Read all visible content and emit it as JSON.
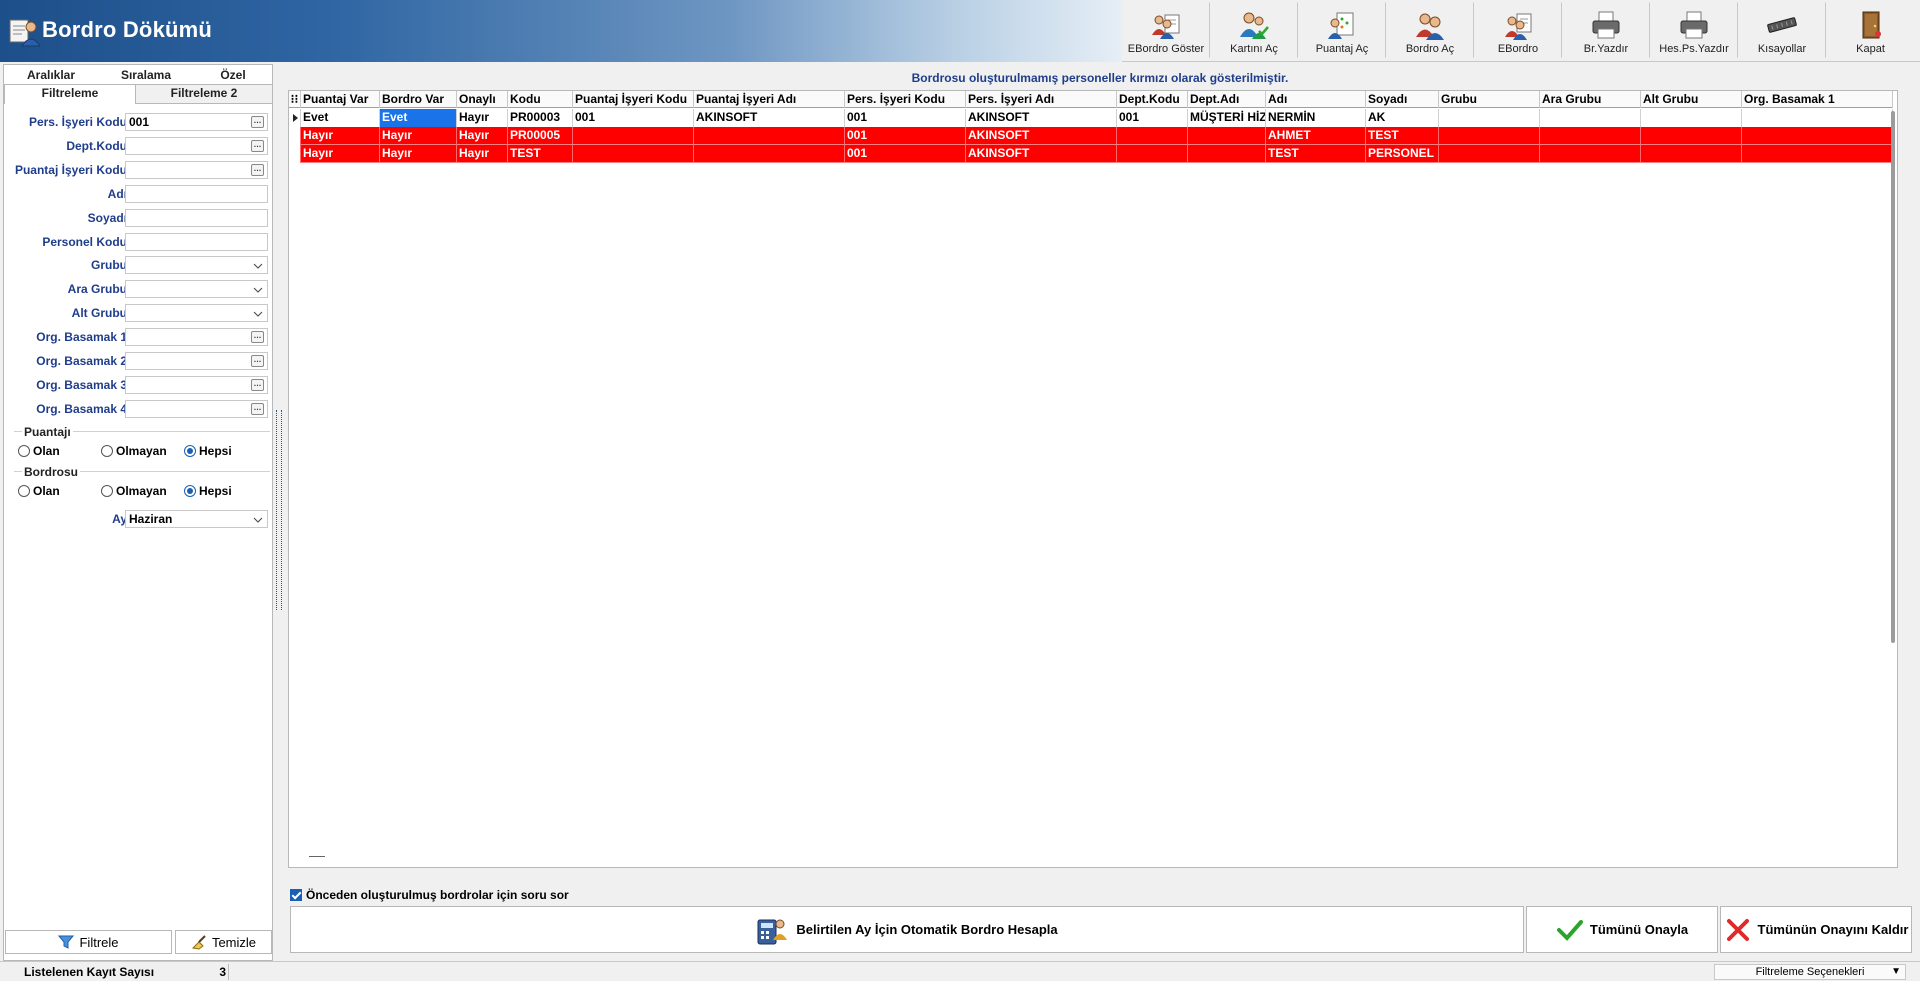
{
  "window": {
    "title": "Bordro Dökümü"
  },
  "toolbar": [
    {
      "label": "EBordro Göster",
      "icon": "people-document-icon"
    },
    {
      "label": "Kartını Aç",
      "icon": "person-check-icon"
    },
    {
      "label": "Puantaj Aç",
      "icon": "timesheet-icon"
    },
    {
      "label": "Bordro Aç",
      "icon": "people-icon"
    },
    {
      "label": "EBordro",
      "icon": "people-document-icon"
    },
    {
      "label": "Br.Yazdır",
      "icon": "printer-icon"
    },
    {
      "label": "Hes.Ps.Yazdır",
      "icon": "printer-icon"
    },
    {
      "label": "Kısayollar",
      "icon": "keyboard-icon"
    },
    {
      "label": "Kapat",
      "icon": "door-exit-icon"
    }
  ],
  "left": {
    "tabs_top": [
      "Aralıklar",
      "Sıralama",
      "Özel"
    ],
    "tabs_bottom": [
      "Filtreleme",
      "Filtreleme 2"
    ],
    "fields": [
      {
        "label": "Pers. İşyeri Kodu",
        "value": "001",
        "type": "lookup"
      },
      {
        "label": "Dept.Kodu",
        "value": "",
        "type": "lookup"
      },
      {
        "label": "Puantaj İşyeri Kodu",
        "value": "",
        "type": "lookup"
      },
      {
        "label": "Adı",
        "value": "",
        "type": "text"
      },
      {
        "label": "Soyadı",
        "value": "",
        "type": "text"
      },
      {
        "label": "Personel Kodu",
        "value": "",
        "type": "text"
      },
      {
        "label": "Grubu",
        "value": "",
        "type": "dropdown"
      },
      {
        "label": "Ara Grubu",
        "value": "",
        "type": "dropdown"
      },
      {
        "label": "Alt Grubu",
        "value": "",
        "type": "dropdown"
      },
      {
        "label": "Org. Basamak 1",
        "value": "",
        "type": "lookup"
      },
      {
        "label": "Org. Basamak 2",
        "value": "",
        "type": "lookup"
      },
      {
        "label": "Org. Basamak 3",
        "value": "",
        "type": "lookup"
      },
      {
        "label": "Org. Basamak 4",
        "value": "",
        "type": "lookup"
      }
    ],
    "puantaj": {
      "title": "Puantajı",
      "options": [
        "Olan",
        "Olmayan",
        "Hepsi"
      ],
      "selected": "Hepsi"
    },
    "bordro": {
      "title": "Bordrosu",
      "options": [
        "Olan",
        "Olmayan",
        "Hepsi"
      ],
      "selected": "Hepsi"
    },
    "month": {
      "label": "Ay",
      "value": "Haziran"
    },
    "filter_button": "Filtrele",
    "clear_button": "Temizle"
  },
  "notice": "Bordrosu oluşturulmamış personeller kırmızı olarak gösterilmiştir.",
  "grid": {
    "columns": [
      "Puantaj Var",
      "Bordro Var",
      "Onaylı",
      "Kodu",
      "Puantaj İşyeri Kodu",
      "Puantaj İşyeri Adı",
      "Pers. İşyeri Kodu",
      "Pers. İşyeri Adı",
      "Dept.Kodu",
      "Dept.Adı",
      "Adı",
      "Soyadı",
      "Grubu",
      "Ara Grubu",
      "Alt Grubu",
      "Org. Basamak 1"
    ],
    "rows": [
      {
        "red": false,
        "cells": [
          "Evet",
          "Evet",
          "Hayır",
          "PR00003",
          "001",
          "AKINSOFT",
          "001",
          "AKINSOFT",
          "001",
          "MÜŞTERİ HİZ",
          "NERMİN",
          "AK",
          "",
          "",
          "",
          ""
        ]
      },
      {
        "red": true,
        "cells": [
          "Hayır",
          "Hayır",
          "Hayır",
          "PR00005",
          "",
          "",
          "001",
          "AKINSOFT",
          "",
          "",
          "AHMET",
          "TEST",
          "",
          "",
          "",
          ""
        ]
      },
      {
        "red": true,
        "cells": [
          "Hayır",
          "Hayır",
          "Hayır",
          "TEST",
          "",
          "",
          "001",
          "AKINSOFT",
          "",
          "",
          "TEST",
          "PERSONEL",
          "",
          "",
          "",
          ""
        ]
      }
    ]
  },
  "bottom": {
    "checkbox_label": "Önceden oluşturulmuş bordrolar için soru sor",
    "checkbox_checked": true,
    "calc_button": "Belirtilen Ay İçin Otomatik Bordro Hesapla",
    "approve_button": "Tümünü Onayla",
    "unapprove_button": "Tümünün Onayını Kaldır"
  },
  "status": {
    "label": "Listelenen Kayıt Sayısı",
    "count": "3",
    "filter_options": "Filtreleme Seçenekleri"
  },
  "colors": {
    "accent": "#1f3d8a",
    "title_band": "#1d4f8a",
    "missing_row": "#ff0000",
    "selection": "#1a73e8"
  }
}
